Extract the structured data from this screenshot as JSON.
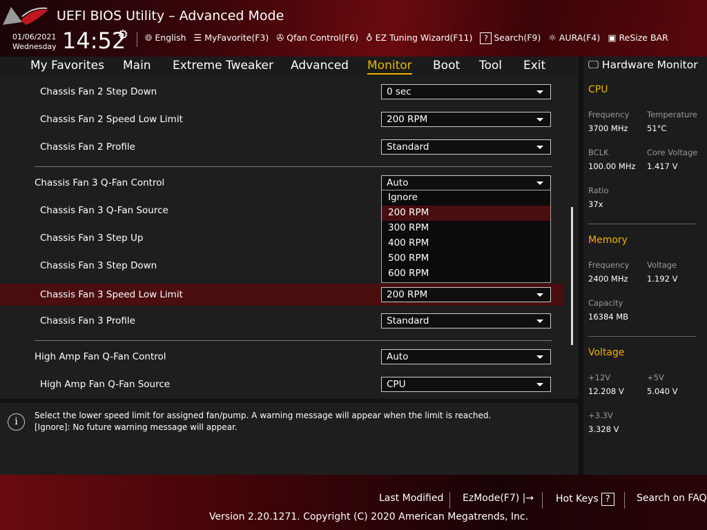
{
  "header": {
    "title": "UEFI BIOS Utility – Advanced Mode",
    "date": "01/06/2021",
    "day": "Wednesday",
    "time": "14:52",
    "tools": [
      {
        "icon": "globe-icon",
        "label": "English"
      },
      {
        "icon": "list-icon",
        "label": "MyFavorite(F3)"
      },
      {
        "icon": "fan-icon",
        "label": "Qfan Control(F6)"
      },
      {
        "icon": "lightbulb-icon",
        "label": "EZ Tuning Wizard(F11)"
      },
      {
        "icon": "help-icon",
        "label": "Search(F9)"
      },
      {
        "icon": "aura-icon",
        "label": "AURA(F4)"
      },
      {
        "icon": "resize-bar-icon",
        "label": "ReSize BAR"
      }
    ]
  },
  "nav": {
    "tabs": [
      "My Favorites",
      "Main",
      "Extreme Tweaker",
      "Advanced",
      "Monitor",
      "Boot",
      "Tool",
      "Exit"
    ],
    "active": "Monitor"
  },
  "rows": [
    {
      "label": "Chassis Fan 2 Step Down",
      "value": "0 sec"
    },
    {
      "label": "Chassis Fan 2 Speed Low Limit",
      "value": "200 RPM"
    },
    {
      "label": "Chassis Fan 2 Profile",
      "value": "Standard"
    },
    {
      "label": "Chassis Fan 3 Q-Fan Control",
      "value": "Auto"
    },
    {
      "label": "Chassis Fan 3 Q-Fan Source",
      "value": ""
    },
    {
      "label": "Chassis Fan 3 Step Up",
      "value": ""
    },
    {
      "label": "Chassis Fan 3 Step Down",
      "value": ""
    },
    {
      "label": "Chassis Fan 3 Speed Low Limit",
      "value": "200 RPM"
    },
    {
      "label": "Chassis Fan 3 Profile",
      "value": "Standard"
    },
    {
      "label": "High Amp Fan Q-Fan Control",
      "value": "Auto"
    },
    {
      "label": "High Amp Fan Q-Fan Source",
      "value": "CPU"
    }
  ],
  "dropdown_options": [
    "Ignore",
    "200 RPM",
    "300 RPM",
    "400 RPM",
    "500 RPM",
    "600 RPM"
  ],
  "help": {
    "line1": "Select the lower speed limit for assigned fan/pump. A warning message will appear when the limit is reached.",
    "line2": "[Ignore]: No future warning message will appear."
  },
  "hw": {
    "title": "Hardware Monitor",
    "cpu": {
      "title": "CPU",
      "freq_k": "Frequency",
      "freq": "3700 MHz",
      "temp_k": "Temperature",
      "temp": "51°C",
      "bclk_k": "BCLK",
      "bclk": "100.00 MHz",
      "cv_k": "Core Voltage",
      "cv": "1.417 V",
      "ratio_k": "Ratio",
      "ratio": "37x"
    },
    "mem": {
      "title": "Memory",
      "freq_k": "Frequency",
      "freq": "2400 MHz",
      "volt_k": "Voltage",
      "volt": "1.192 V",
      "cap_k": "Capacity",
      "cap": "16384 MB"
    },
    "volt": {
      "title": "Voltage",
      "v12_k": "+12V",
      "v12": "12.208 V",
      "v5_k": "+5V",
      "v5": "5.040 V",
      "v33_k": "+3.3V",
      "v33": "3.328 V"
    }
  },
  "footer": {
    "last_modified": "Last Modified",
    "ezmode": "EzMode(F7)",
    "hotkeys": "Hot Keys",
    "hotkeys_icon": "?",
    "faq": "Search on FAQ",
    "version": "Version 2.20.1271. Copyright (C) 2020 American Megatrends, Inc."
  }
}
